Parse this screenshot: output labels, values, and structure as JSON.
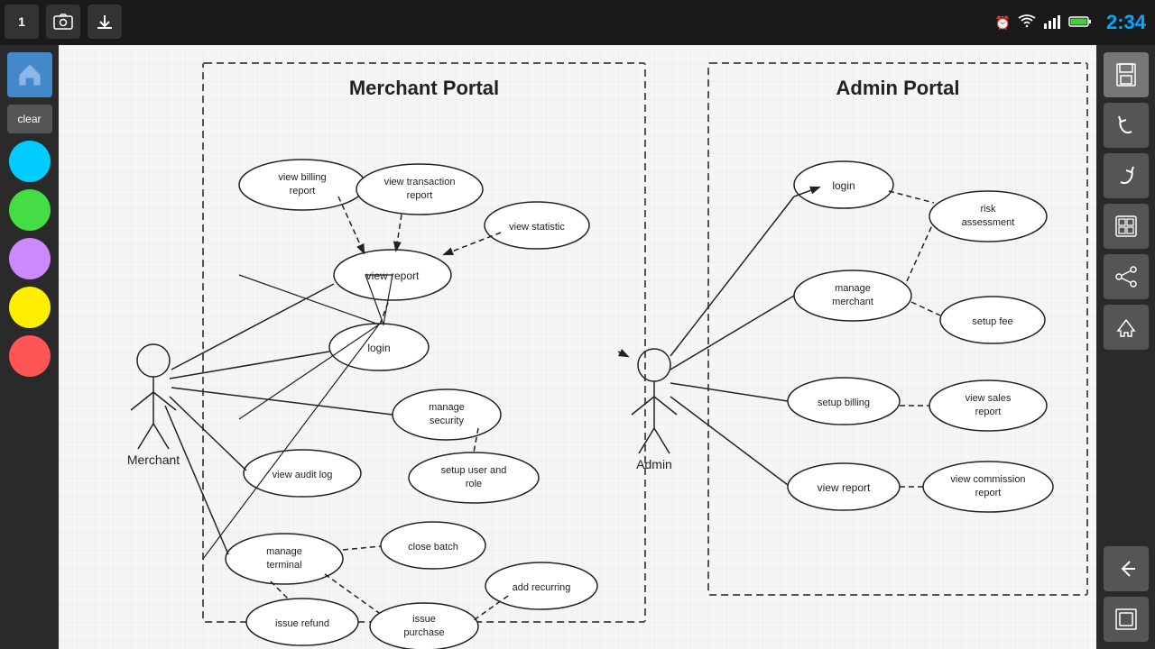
{
  "statusBar": {
    "time": "2:34",
    "icons": [
      "clock",
      "wifi",
      "signal",
      "battery"
    ]
  },
  "sidebar": {
    "homeIcon": "home",
    "clearLabel": "clear",
    "colors": [
      "#00ccff",
      "#44dd44",
      "#cc88ff",
      "#ffee00",
      "#ff5555"
    ]
  },
  "toolbar": {
    "buttons": [
      "save",
      "undo",
      "redo",
      "gallery",
      "share",
      "home",
      "back"
    ]
  },
  "diagram": {
    "merchantPortalTitle": "Merchant Portal",
    "adminPortalTitle": "Admin Portal",
    "merchantActorLabel": "Merchant",
    "adminActorLabel": "Admin",
    "merchantNodes": [
      "view billing report",
      "view transaction report",
      "view statistic",
      "view report",
      "login",
      "manage security",
      "view audit log",
      "setup user and role",
      "manage terminal",
      "close batch",
      "add recurring",
      "issue purchase",
      "issue refund"
    ],
    "adminNodes": [
      "login",
      "risk assessment",
      "manage merchant",
      "setup fee",
      "setup billing",
      "view sales report",
      "view report",
      "view commission report"
    ]
  }
}
